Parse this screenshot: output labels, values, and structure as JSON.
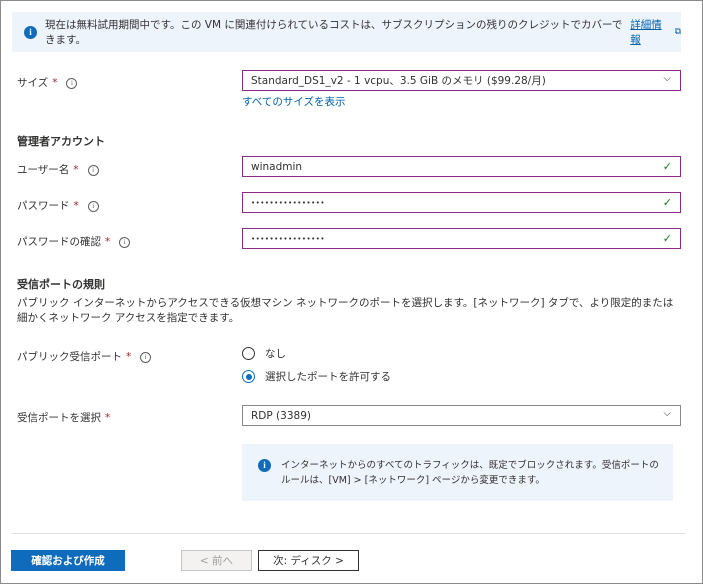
{
  "banner": {
    "text": "現在は無料試用期間中です。この VM に関連付けられているコストは、サブスクリプションの残りのクレジットでカバーできます。",
    "link": "詳細情報"
  },
  "size": {
    "label": "サイズ",
    "value": "Standard_DS1_v2 - 1 vcpu、3.5 GiB のメモリ ($99.28/月)",
    "link": "すべてのサイズを表示"
  },
  "admin": {
    "title": "管理者アカウント",
    "username_label": "ユーザー名",
    "username_value": "winadmin",
    "password_label": "パスワード",
    "password_value": "••••••••••••••••",
    "confirm_label": "パスワードの確認",
    "confirm_value": "••••••••••••••••"
  },
  "ports": {
    "title": "受信ポートの規則",
    "description": "パブリック インターネットからアクセスできる仮想マシン ネットワークのポートを選択します。[ネットワーク] タブで、より限定的または細かくネットワーク アクセスを指定できます。",
    "public_label": "パブリック受信ポート",
    "option_none": "なし",
    "option_allow": "選択したポートを許可する",
    "selected_option": "allow",
    "select_label": "受信ポートを選択",
    "select_value": "RDP (3389)",
    "info_text": "インターネットからのすべてのトラフィックは、既定でブロックされます。受信ポートのルールは、[VM] > [ネットワーク] ページから変更できます。"
  },
  "common": {
    "required": "*",
    "tooltip": "i"
  },
  "footer": {
    "review_create": "確認および作成",
    "previous": "< 前へ",
    "next": "次: ディスク >"
  },
  "colors": {
    "accent": "#0f6cbd",
    "valid_border": "#8a2c86",
    "check": "#107c10",
    "required": "#a4262c"
  }
}
